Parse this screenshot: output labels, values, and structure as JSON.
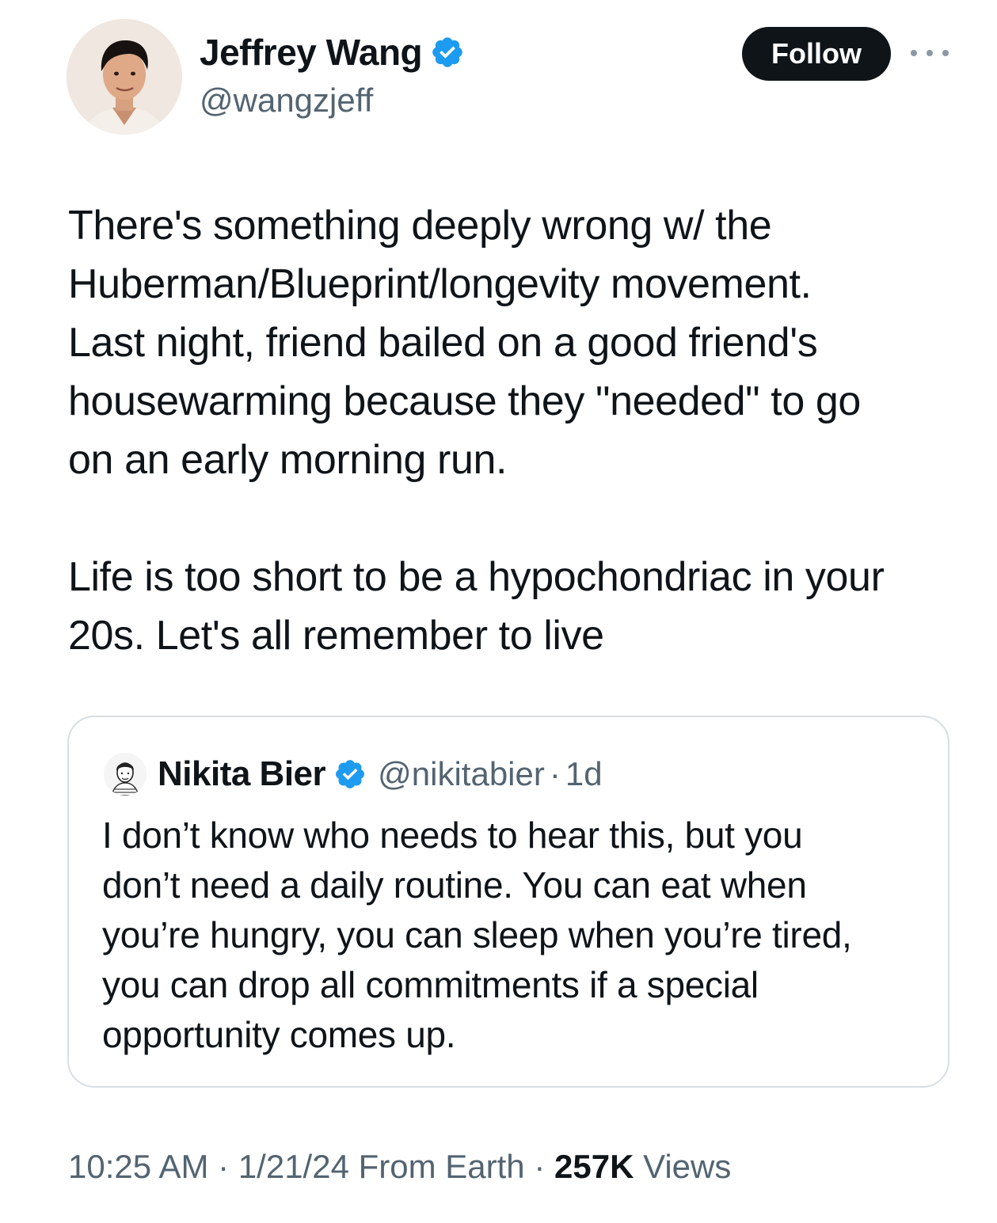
{
  "author": {
    "name": "Jeffrey Wang",
    "handle": "@wangzjeff",
    "verified": true
  },
  "follow_label": "Follow",
  "more_icon": "more-horizontal-icon",
  "tweet": {
    "paragraph_1": "There's something deeply wrong w/ the\nHuberman/Blueprint/longevity movement.\nLast night, friend bailed on a good friend's\nhousewarming because they \"needed\" to go\non an early morning run.",
    "paragraph_2": "Life is too short to be a hypochondriac in your\n20s. Let's all remember to live"
  },
  "quoted_tweet": {
    "name": "Nikita Bier",
    "handle": "@nikitabier",
    "separator": "·",
    "time": "1d",
    "verified": true,
    "text": "I don’t know who needs to hear this, but you\ndon’t need a daily routine. You can eat when\nyou’re hungry, you can sleep when you’re tired,\nyou can drop all commitments if a special\nopportunity comes up."
  },
  "meta": {
    "time": "10:25 AM",
    "separator": "·",
    "date": "1/21/24",
    "location": "From Earth",
    "views_count": "257K",
    "views_label": "Views"
  },
  "colors": {
    "verified_badge": "#1d9bf0",
    "follow_button_bg": "#0f1419",
    "secondary_text": "#536471",
    "card_border": "#d8dee3"
  }
}
